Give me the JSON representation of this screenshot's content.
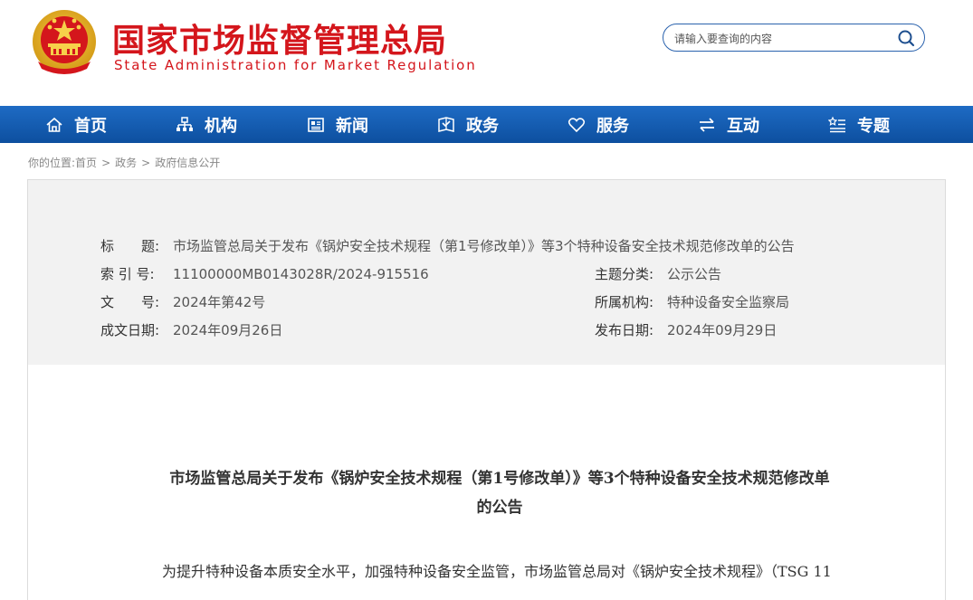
{
  "header": {
    "title_cn": "国家市场监督管理总局",
    "title_en": "State Administration for Market Regulation",
    "emblem_icon": "national-emblem-icon",
    "brand_color": "#d4161c"
  },
  "search": {
    "placeholder": "请输入要查询的内容",
    "icon": "search-icon"
  },
  "nav": {
    "background": "#1560b8",
    "items": [
      {
        "label": "首页",
        "icon": "home-icon"
      },
      {
        "label": "机构",
        "icon": "org-icon"
      },
      {
        "label": "新闻",
        "icon": "news-icon"
      },
      {
        "label": "政务",
        "icon": "government-icon"
      },
      {
        "label": "服务",
        "icon": "heart-icon"
      },
      {
        "label": "互动",
        "icon": "exchange-icon"
      },
      {
        "label": "专题",
        "icon": "topics-icon"
      }
    ]
  },
  "breadcrumb": {
    "prefix": "你的位置:",
    "items": [
      "首页",
      "政务",
      "政府信息公开"
    ],
    "separator": ">"
  },
  "meta": {
    "title_label": "标　　题:",
    "title_value": "市场监管总局关于发布《锅炉安全技术规程（第1号修改单）》等3个特种设备安全技术规范修改单的公告",
    "index_label": "索 引 号:",
    "index_value": "11100000MB0143028R/2024-915516",
    "topic_label": "主题分类:",
    "topic_value": "公示公告",
    "doc_label": "文　　号:",
    "doc_value": "2024年第42号",
    "org_label": "所属机构:",
    "org_value": "特种设备安全监察局",
    "created_label": "成文日期:",
    "created_value": "2024年09月26日",
    "published_label": "发布日期:",
    "published_value": "2024年09月29日"
  },
  "article": {
    "title": "市场监管总局关于发布《锅炉安全技术规程（第1号修改单）》等3个特种设备安全技术规范修改单的公告",
    "body": "为提升特种设备本质安全水平，加强特种设备安全监管，市场监管总局对《锅炉安全技术规程》（TSG 11"
  }
}
